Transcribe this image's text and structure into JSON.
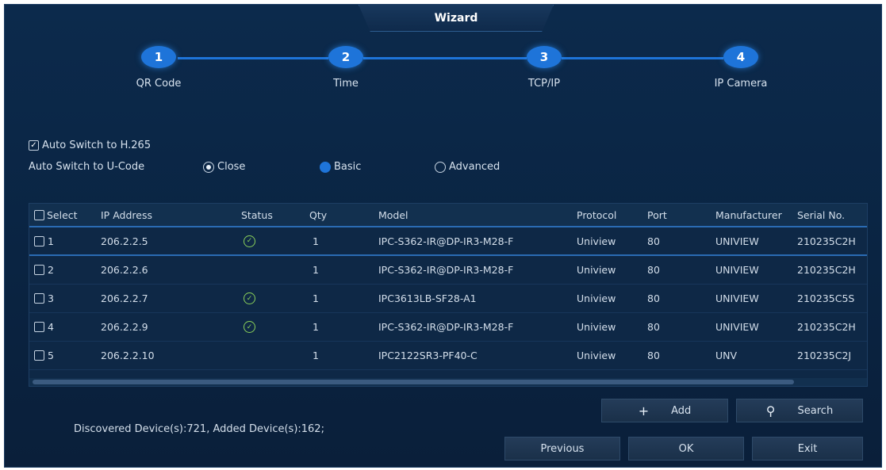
{
  "window": {
    "title": "Wizard"
  },
  "steps": [
    {
      "number": "1",
      "label": "QR Code"
    },
    {
      "number": "2",
      "label": "Time"
    },
    {
      "number": "3",
      "label": "TCP/IP"
    },
    {
      "number": "4",
      "label": "IP Camera"
    }
  ],
  "options": {
    "h265_label": "Auto Switch to H.265",
    "h265_checked": true,
    "ucode_label": "Auto Switch to U-Code",
    "ucode_choices": [
      "Close",
      "Basic",
      "Advanced"
    ],
    "ucode_selected": "Close"
  },
  "table": {
    "headers": [
      "Select",
      "IP Address",
      "Status",
      "Qty",
      "Model",
      "Protocol",
      "Port",
      "Manufacturer",
      "Serial No."
    ],
    "rows": [
      {
        "select": "1",
        "ip": "206.2.2.5",
        "status_ok": true,
        "qty": "1",
        "model": "IPC-S362-IR@DP-IR3-M28-F",
        "protocol": "Uniview",
        "port": "80",
        "manufacturer": "UNIVIEW",
        "serial": "210235C2H"
      },
      {
        "select": "2",
        "ip": "206.2.2.6",
        "status_ok": false,
        "qty": "1",
        "model": "IPC-S362-IR@DP-IR3-M28-F",
        "protocol": "Uniview",
        "port": "80",
        "manufacturer": "UNIVIEW",
        "serial": "210235C2H"
      },
      {
        "select": "3",
        "ip": "206.2.2.7",
        "status_ok": true,
        "qty": "1",
        "model": "IPC3613LB-SF28-A1",
        "protocol": "Uniview",
        "port": "80",
        "manufacturer": "UNIVIEW",
        "serial": "210235C5S"
      },
      {
        "select": "4",
        "ip": "206.2.2.9",
        "status_ok": true,
        "qty": "1",
        "model": "IPC-S362-IR@DP-IR3-M28-F",
        "protocol": "Uniview",
        "port": "80",
        "manufacturer": "UNIVIEW",
        "serial": "210235C2H"
      },
      {
        "select": "5",
        "ip": "206.2.2.10",
        "status_ok": false,
        "qty": "1",
        "model": "IPC2122SR3-PF40-C",
        "protocol": "Uniview",
        "port": "80",
        "manufacturer": "UNV",
        "serial": "210235C2J"
      }
    ]
  },
  "summary": "Discovered Device(s):721, Added Device(s):162;",
  "buttons": {
    "add": "Add",
    "search": "Search",
    "previous": "Previous",
    "ok": "OK",
    "exit": "Exit"
  },
  "icons": {
    "add": "plus-icon",
    "search": "search-icon",
    "status_ok": "check-circle-icon"
  },
  "colors": {
    "accent": "#1e74d9",
    "background": "#0c2a4c",
    "status_ok": "#8ad05a"
  }
}
